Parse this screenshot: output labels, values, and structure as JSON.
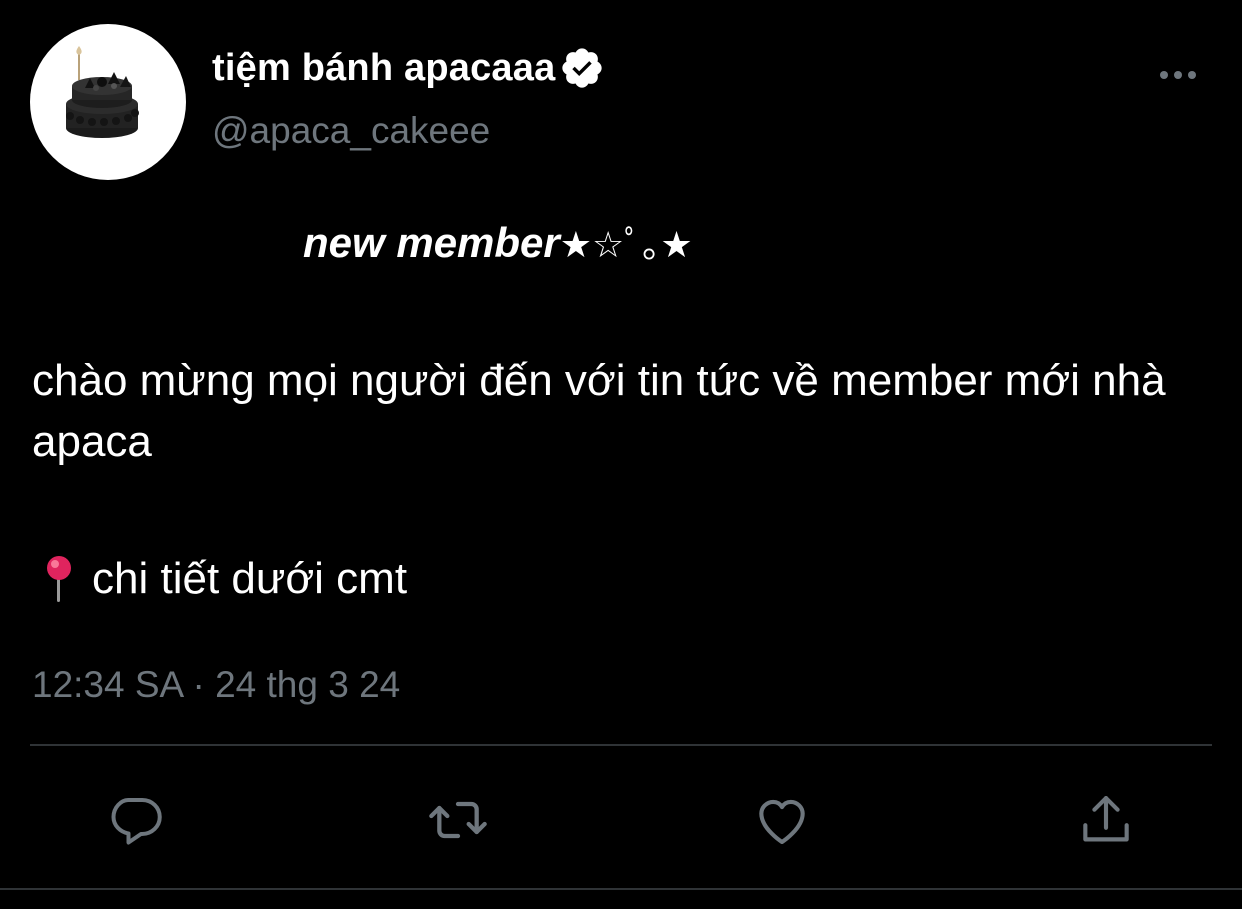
{
  "tweet": {
    "author": {
      "display_name": "tiệm bánh apacaaa",
      "handle": "@apaca_cakeee",
      "verified": true
    },
    "headline": {
      "main": "new member",
      "decoration": "★☆ﾟ｡★"
    },
    "body_lines": [
      "chào mừng mọi người đến với tin tức về member mới nhà apaca"
    ],
    "pin_text": "chi tiết dưới cmt",
    "timestamp": "12:34 SA · 24 thg 3 24"
  },
  "actions": {
    "reply_icon": "reply-icon",
    "retweet_icon": "retweet-icon",
    "like_icon": "heart-icon",
    "share_icon": "share-icon"
  },
  "colors": {
    "background": "#000000",
    "text_primary": "#ffffff",
    "text_secondary": "#6e767d",
    "icon": "#6e767d",
    "divider": "#2f3336"
  }
}
